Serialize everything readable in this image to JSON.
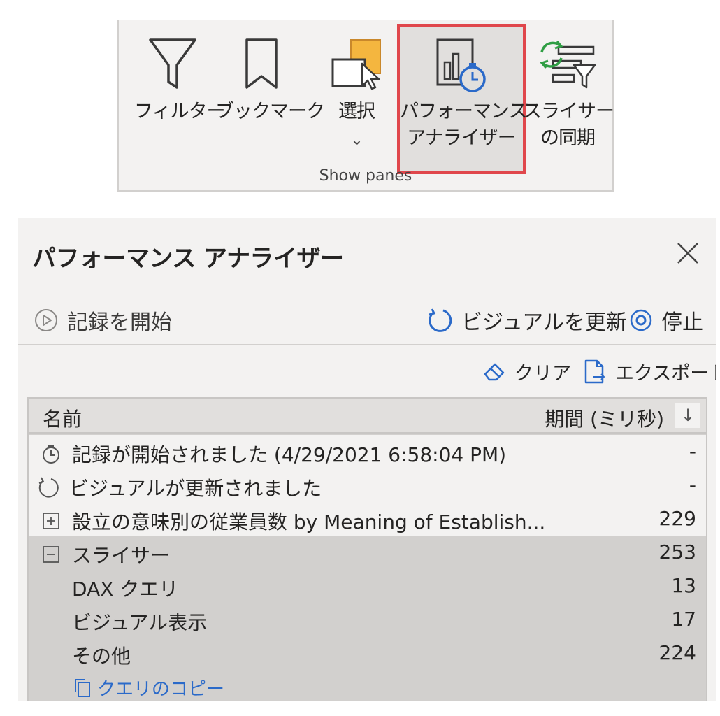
{
  "ribbon": {
    "buttons": [
      {
        "id": "filter",
        "label": "フィルター",
        "icon": "funnel-icon"
      },
      {
        "id": "bookmark",
        "label": "ブックマーク",
        "icon": "bookmark-icon"
      },
      {
        "id": "selection",
        "label": "選択",
        "chevron": "⌄",
        "icon": "selection-pane-icon"
      },
      {
        "id": "performance",
        "label_line1": "パフォーマンス",
        "label_line2": "アナライザー",
        "icon": "performance-analyzer-icon"
      },
      {
        "id": "sync",
        "label_line1": "スライサー",
        "label_line2": "の同期",
        "icon": "sync-slicers-icon"
      }
    ],
    "group_label": "Show panes",
    "highlight_color": "#e0474c"
  },
  "panel": {
    "title": "パフォーマンス アナライザー",
    "start_recording": "記録を開始",
    "refresh_visuals": "ビジュアルを更新",
    "stop": "停止",
    "clear": "クリア",
    "export": "エクスポート"
  },
  "table": {
    "col_name": "名前",
    "col_duration": "期間 (ミリ秒)",
    "sort_icon": "↓",
    "rows": [
      {
        "icon": "stopwatch-icon",
        "name": "記録が開始されました (4/29/2021 6:58:04 PM)",
        "duration": "-"
      },
      {
        "icon": "refresh-icon",
        "name": "ビジュアルが更新されました",
        "duration": "-"
      },
      {
        "icon": "expand-icon",
        "name": "設立の意味別の従業員数 by Meaning of Establish...",
        "duration": "229"
      },
      {
        "icon": "collapse-icon",
        "name": "スライサー",
        "duration": "253"
      },
      {
        "name": "DAX クエリ",
        "duration": "13"
      },
      {
        "name": "ビジュアル表示",
        "duration": "17"
      },
      {
        "name": "その他",
        "duration": "224"
      }
    ],
    "copy_query": "クエリのコピー"
  },
  "colors": {
    "accent_blue": "#2b6ac9",
    "icon_orange": "#f4b63f",
    "highlight_red": "#e0474c",
    "sync_green": "#2f9e44"
  }
}
